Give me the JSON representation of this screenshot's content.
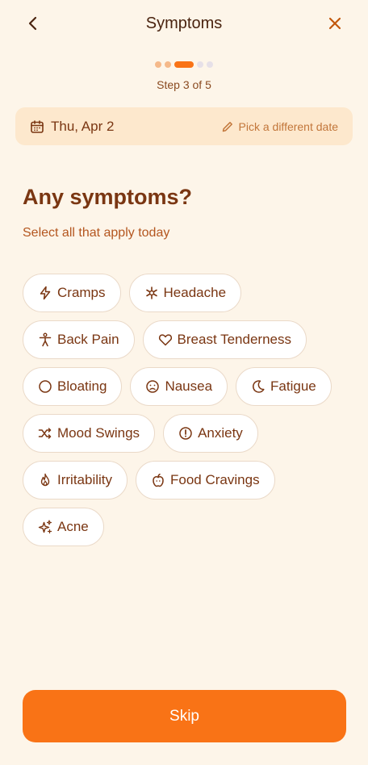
{
  "header": {
    "title": "Symptoms",
    "back_icon": "chevron-left-icon",
    "close_icon": "close-icon"
  },
  "progress": {
    "current_step": 3,
    "total_steps": 5,
    "label": "Step 3 of 5"
  },
  "date_bar": {
    "date": "Thu, Apr 2",
    "change_label": "Pick a different date",
    "calendar_icon": "calendar-icon",
    "pencil_icon": "pencil-icon"
  },
  "question": {
    "heading": "Any symptoms?",
    "subheading": "Select all that apply today"
  },
  "symptoms": [
    {
      "label": "Cramps",
      "icon": "lightning-icon"
    },
    {
      "label": "Headache",
      "icon": "asterisk-icon"
    },
    {
      "label": "Back Pain",
      "icon": "person-icon"
    },
    {
      "label": "Breast Tenderness",
      "icon": "heart-icon"
    },
    {
      "label": "Bloating",
      "icon": "circle-icon"
    },
    {
      "label": "Nausea",
      "icon": "sick-face-icon"
    },
    {
      "label": "Fatigue",
      "icon": "moon-icon"
    },
    {
      "label": "Mood Swings",
      "icon": "shuffle-icon"
    },
    {
      "label": "Anxiety",
      "icon": "alert-circle-icon"
    },
    {
      "label": "Irritability",
      "icon": "flame-icon"
    },
    {
      "label": "Food Cravings",
      "icon": "apple-icon"
    },
    {
      "label": "Acne",
      "icon": "sparkles-icon"
    }
  ],
  "footer": {
    "skip_label": "Skip"
  },
  "colors": {
    "background": "#fdf5e9",
    "accent": "#f97316",
    "text": "#7a3612"
  }
}
